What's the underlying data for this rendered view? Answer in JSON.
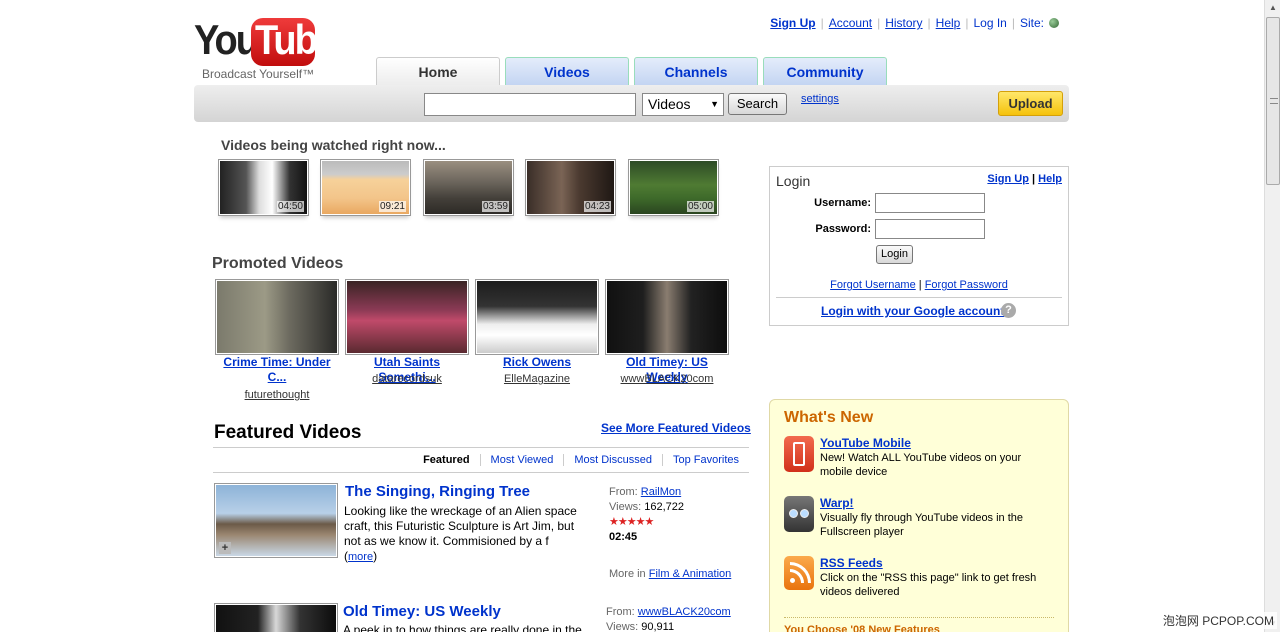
{
  "header": {
    "logo_you": "You",
    "logo_tube": "Tube",
    "slogan": "Broadcast Yourself™",
    "top_links": [
      {
        "label": "Sign Up",
        "bold": true
      },
      {
        "label": "Account"
      },
      {
        "label": "History"
      },
      {
        "label": "Help"
      },
      {
        "label": "Log In"
      },
      {
        "label": "Site:"
      }
    ],
    "tabs": [
      {
        "label": "Home",
        "active": true
      },
      {
        "label": "Videos"
      },
      {
        "label": "Channels"
      },
      {
        "label": "Community"
      }
    ]
  },
  "search": {
    "value": "",
    "select_value": "Videos",
    "button_label": "Search",
    "settings_label": "settings",
    "upload_label": "Upload"
  },
  "watched": {
    "title": "Videos being watched right now...",
    "items": [
      {
        "duration": "04:50"
      },
      {
        "duration": "09:21"
      },
      {
        "duration": "03:59"
      },
      {
        "duration": "04:23"
      },
      {
        "duration": "05:00"
      }
    ]
  },
  "promoted": {
    "title": "Promoted Videos",
    "items": [
      {
        "title_line1": "Crime Time: Under",
        "title_line2": "C...",
        "by": "futurethought"
      },
      {
        "title_line1": "Utah Saints Somethi...",
        "title_line2": "",
        "by": "datarecordsuk"
      },
      {
        "title_line1": "Rick Owens",
        "title_line2": "",
        "by": "ElleMagazine"
      },
      {
        "title_line1": "Old Timey: US Weekly",
        "title_line2": "",
        "by": "wwwBLACK20com"
      }
    ]
  },
  "featured": {
    "title": "Featured Videos",
    "see_more": "See More Featured Videos",
    "tabs": [
      "Featured",
      "Most Viewed",
      "Most Discussed",
      "Top Favorites"
    ],
    "items": [
      {
        "title": "The Singing, Ringing Tree",
        "desc": "Looking like the wreckage of an Alien space craft, this Futuristic Sculpture is Art Jim, but not as we know it. Commisioned by a f",
        "more_prefix": "(",
        "more_label": "more",
        "more_suffix": ")",
        "from_label": "From:",
        "from": "RailMon",
        "views_label": "Views:",
        "views": "162,722",
        "rating": 4.5,
        "stars": "★★★★★",
        "duration": "02:45",
        "category_label": "More in",
        "category": "Film & Animation"
      },
      {
        "title": "Old Timey: US Weekly",
        "desc": "A peek in to how things are really done in the",
        "from_label": "From:",
        "from": "wwwBLACK20com",
        "views_label": "Views:",
        "views": "90,911"
      }
    ]
  },
  "login": {
    "title": "Login",
    "signup_label": "Sign Up",
    "separator": "|",
    "help_label": "Help",
    "username_label": "Username:",
    "password_label": "Password:",
    "button_label": "Login",
    "forgot_username": "Forgot Username",
    "forgot_password": "Forgot Password",
    "google_label": "Login with your Google account",
    "help_icon": "?"
  },
  "whats_new": {
    "title": "What's New",
    "items": [
      {
        "title": "YouTube Mobile",
        "text_line1": "New! Watch ALL YouTube videos on your",
        "text_line2": "mobile device",
        "icon": "mobile-phone-icon",
        "color": "#e8452e"
      },
      {
        "title": "Warp!",
        "text_line1": "Visually fly through YouTube videos in the",
        "text_line2": "Fullscreen player",
        "icon": "warp-icon",
        "color": "#4a4a4a"
      },
      {
        "title": "RSS Feeds",
        "text_line1": "Click on the \"RSS this page\" link to get fresh",
        "text_line2": "videos delivered",
        "icon": "rss-icon",
        "color": "#f7931e"
      }
    ],
    "more": "You Choose '08 New Features"
  },
  "watermark": "泡泡网 PCPOP.COM",
  "colors": {
    "link": "#0033cc",
    "accent": "#cc6600",
    "upload": "#f5c20c"
  }
}
